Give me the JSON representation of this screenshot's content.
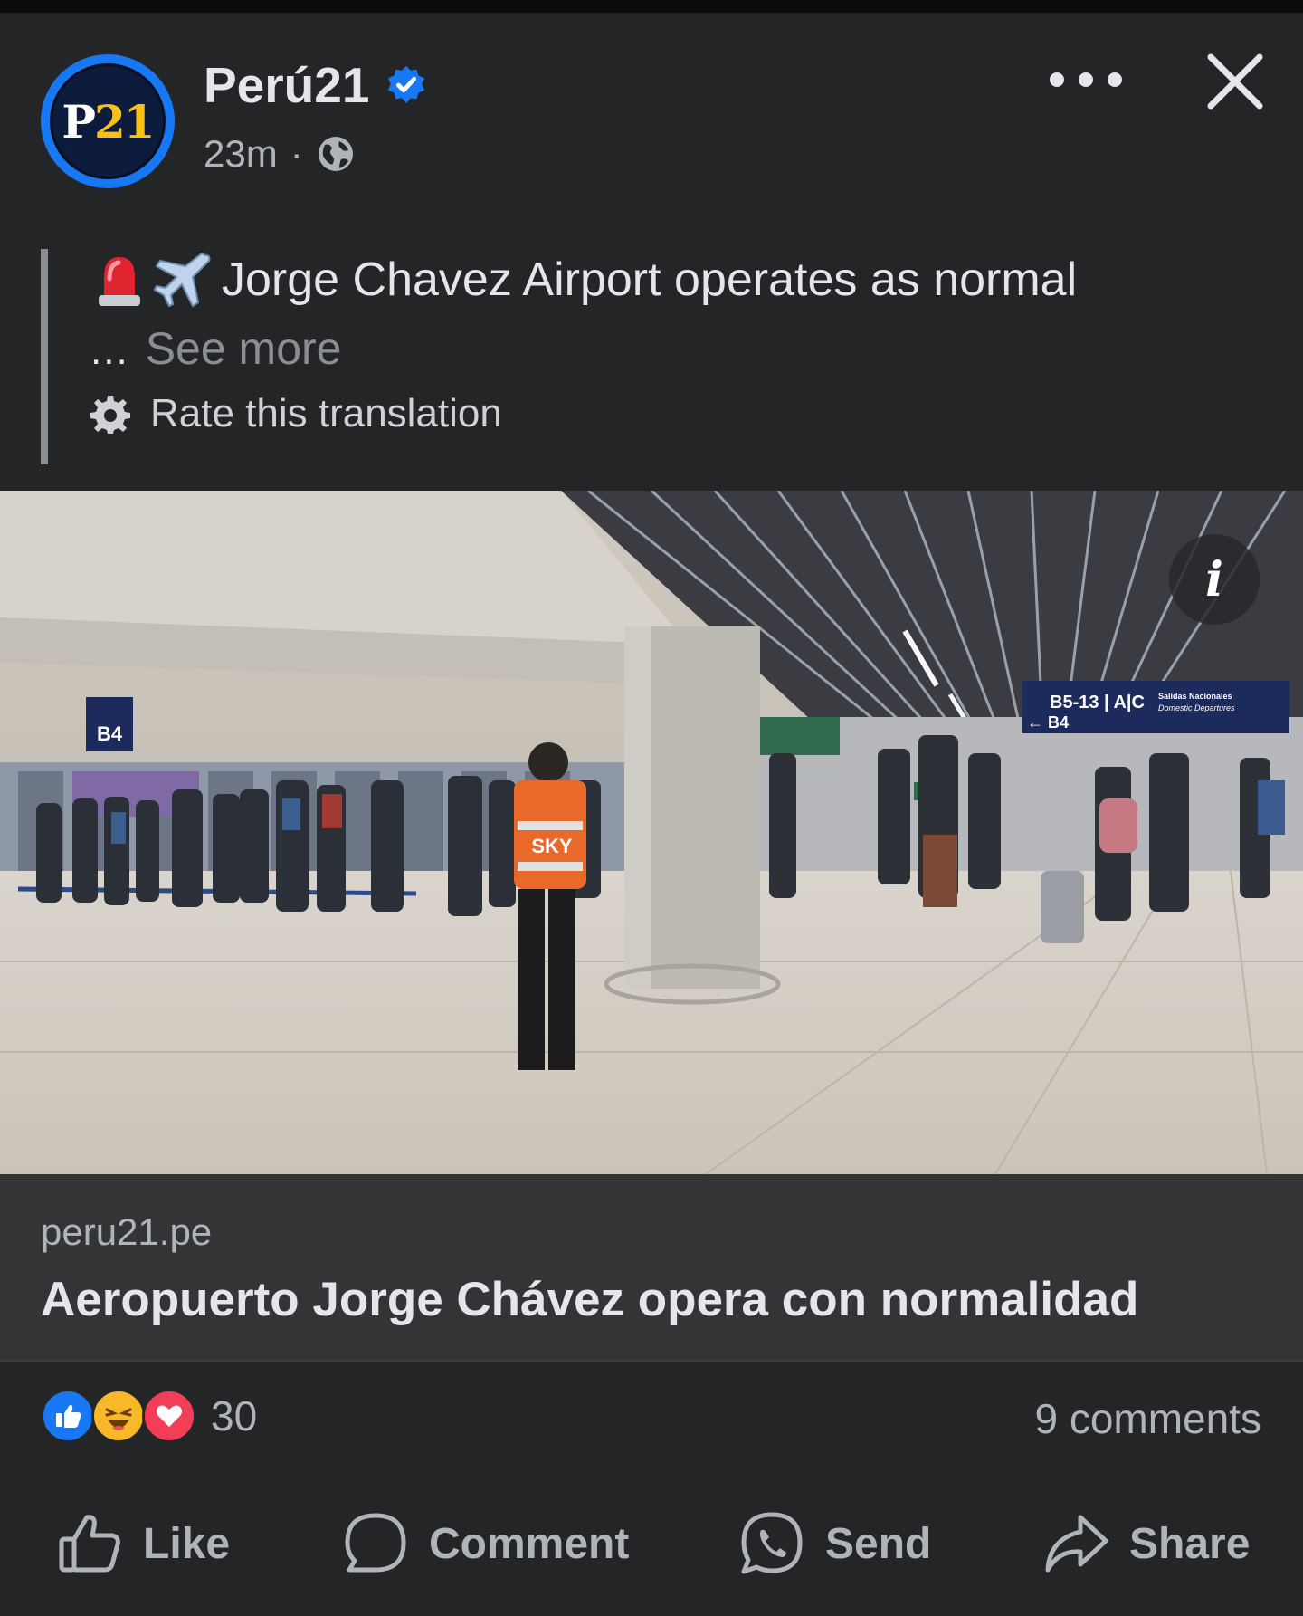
{
  "header": {
    "page_name": "Perú21",
    "avatar_text_letter": "P",
    "avatar_text_number": "21",
    "time": "23m",
    "separator": "·",
    "privacy_icon": "globe-icon",
    "verified_icon": "verified-badge-icon",
    "more_icon": "more-dots-icon",
    "close_icon": "close-icon"
  },
  "post": {
    "emoji_1": "siren-icon",
    "emoji_2": "airplane-icon",
    "text": "Jorge Chavez Airport operates as normal",
    "see_more_dots": "...",
    "see_more": "See more",
    "rate_translation": "Rate this translation"
  },
  "photo": {
    "info_icon": "i",
    "sign_gate": "B4",
    "sign_vest": "SKY",
    "sign_direction_1": "B5-13 | A|C",
    "sign_direction_2": "← B4",
    "sign_domestic_1": "Salidas Nacionales",
    "sign_domestic_2": "Domestic Departures"
  },
  "link": {
    "domain": "peru21.pe",
    "title": "Aeropuerto Jorge Chávez opera con normalidad"
  },
  "stats": {
    "reaction_count": "30",
    "comments": "9 comments"
  },
  "actions": {
    "like": "Like",
    "comment": "Comment",
    "send": "Send",
    "share": "Share"
  },
  "colors": {
    "background": "#242527",
    "link_box": "#323436",
    "brand_blue": "#1877f2",
    "text_primary": "#e4e6eb",
    "text_secondary": "#b0b3b8"
  }
}
